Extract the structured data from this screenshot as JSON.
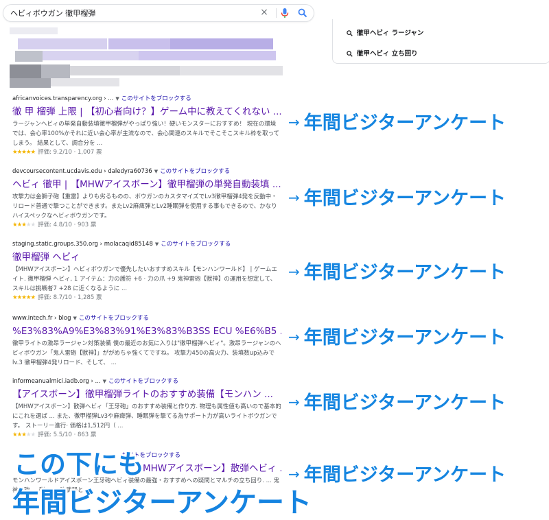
{
  "search": {
    "query": "ヘビィボウガン 徹甲榴弾",
    "clear_symbol": "×"
  },
  "related_searches": [
    {
      "label": "徹甲ヘビィ ラージャン"
    },
    {
      "label": "徹甲ヘビィ 立ち回り"
    }
  ],
  "results": [
    {
      "domain": "africanvoices.transparency.org",
      "path": "› ...",
      "block_label": "このサイトをブロックする",
      "title": "徹 甲 榴弾 上限 | 【初心者向け？】ゲーム中に教えてくれない ...",
      "snippet": "ラージャンヘビィの単発自動装填徹甲榴弾がやっぱり強い！硬いモンスターにおすすめ！ 現在の環境では、会心率100%かそれに近い会心率が主流なので、会心関連のスキルでそこそこスキル枠を取ってしまう。 結果として、調合分を ...",
      "rating_text": "評価: 9.2/10 · 1,007 票",
      "stars": 5
    },
    {
      "domain": "devcoursecontent.ucdavis.edu",
      "path": "› daledyra60736",
      "block_label": "このサイトをブロックする",
      "title": "ヘビィ 徹甲 | 【MHWアイスボーン】徹甲榴弾の単発自動装填 ...",
      "snippet": "攻撃力は金獅子砲【重雷】よりも劣るものの、ボウガンのカスタマイズでLv3徹甲榴弾4発を反動中・リロード普通で撃つことができます。またLv2麻痺弾とLv2睡眠弾を使用する事もできるので、かなりハイスペックなヘビィボウガンです。",
      "rating_text": "評価: 4.8/10 · 903 票",
      "stars": 2.5
    },
    {
      "domain": "staging.static.groups.350.org",
      "path": "› molacaqid85148",
      "block_label": "このサイトをブロックする",
      "title": "徹甲榴弾 ヘビィ",
      "snippet": "【MHWアイスボーン】ヘビィボウガンで優先したいおすすめスキル【モンハンワールド】 | ゲームエイト. 徹甲榴弾 ヘビィ, 1 アイテム：力の護符 +6 · 力の爪 +9 鬼神雷砲【獣神】の運用を想定して、スキルは挑戦者7 +28 に近くなるように ...",
      "rating_text": "評価: 8.7/10 · 1,285 票",
      "stars": 4.5
    },
    {
      "domain": "www.intech.fr",
      "path": "› blog",
      "block_label": "このサイトをブロックする",
      "title": "%E3%83%A9%E3%83%91%E3%83%B3SS ECU %E6%B5 ...",
      "snippet": "徹甲ライトの激昂ラージャン対策装備 僕の最近のお気に入りは\"徹甲榴弾ヘビィ\"。激昂ラージャンのヘビィボウガン「鬼人雷砲【獣神】」ががめちゃ強くてですね。 攻撃力450の高火力、装填数up込みでlv.3 徹甲榴弾4発リロード、そして、 ...",
      "rating_text": "",
      "stars": 0
    },
    {
      "domain": "informeanualmici.iadb.org",
      "path": "› ...",
      "block_label": "このサイトをブロックする",
      "title": "【アイスボーン】徹甲榴弾ライトのおすすめ装備【モンハン ...",
      "snippet": "【MHWアイスボーン】散弾ヘビィ「王牙砲」のおすすめ装備と作り方. 物理も属性値も高いので基本的にこれを選ば ... また、徹甲榴弾Lv3や麻痺弾、睡眠弾を撃てる為サポート力が高いライトボウガンです。 ストーリー進行· 価格は1,512円（ ...",
      "rating_text": "評価: 5.5/10 · 863 票",
      "stars": 3
    },
    {
      "domain": "",
      "path": "",
      "block_label": "サイトをブロックする",
      "title": "MHWアイスボーン】散弾ヘビィ ...",
      "snippet": "モンハンワールドアイスボーン王牙砲ヘビィ装備の最強・おすすめへの疑問とマルチの立ち回り. ... 鬼神雷砲 ... 弾の ... 強武器と ...",
      "rating_text": "",
      "stars": 0
    }
  ],
  "annotations": {
    "arrow": "→",
    "label": "年間ビジターアンケート",
    "overlay_line1": "この下にも",
    "overlay_line2": "年間ビジターアンケート"
  },
  "colors": {
    "link_visited": "#5a18ab",
    "block_link": "#1a0dab",
    "annotation": "#1585e0",
    "star": "#f4b400"
  }
}
